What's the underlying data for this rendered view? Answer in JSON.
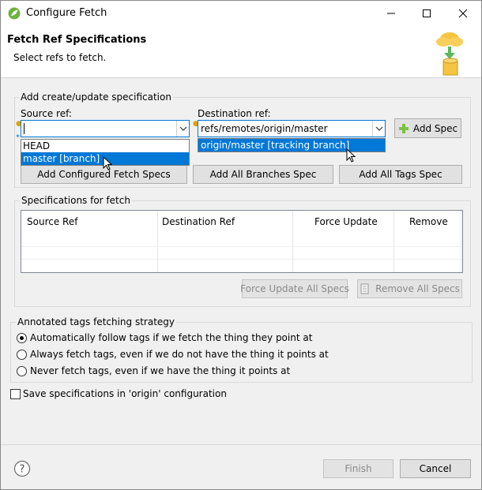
{
  "window": {
    "title": "Configure Fetch",
    "minimize_icon": "minimize-icon",
    "maximize_icon": "maximize-icon",
    "close_icon": "close-icon"
  },
  "header": {
    "title": "Fetch Ref Specifications",
    "description": "Select refs to fetch.",
    "image_icon": "cloud-download-database-icon"
  },
  "create_group": {
    "label": "Add create/update specification",
    "source_label": "Source ref:",
    "source_value": "",
    "destination_label": "Destination ref:",
    "destination_value": "refs/remotes/origin/master",
    "add_spec_label": "Add Spec",
    "source_dropdown": [
      {
        "label": "HEAD",
        "selected": false
      },
      {
        "label": "master [branch]",
        "selected": true
      }
    ],
    "destination_dropdown": [
      {
        "label": "origin/master [tracking branch]",
        "selected": true
      }
    ],
    "add_configured_label": "Add Configured Fetch Specs",
    "add_all_branches_label": "Add All Branches Spec",
    "add_all_tags_label": "Add All Tags Spec"
  },
  "specs_group": {
    "label": "Specifications for fetch",
    "columns": [
      "Source Ref",
      "Destination Ref",
      "Force Update",
      "Remove"
    ],
    "rows": [],
    "force_update_all_label": "Force Update All Specs",
    "remove_all_label": "Remove All Specs"
  },
  "tags_group": {
    "label": "Annotated tags fetching strategy",
    "options": [
      {
        "label": "Automatically follow tags if we fetch the thing they point at",
        "checked": true
      },
      {
        "label": "Always fetch tags, even if we do not have the thing it points at",
        "checked": false
      },
      {
        "label": "Never fetch tags, even if we have the thing it points at",
        "checked": false
      }
    ]
  },
  "save_checkbox": {
    "label": "Save specifications in 'origin' configuration",
    "checked": false
  },
  "footer": {
    "help_icon": "help-icon",
    "finish_label": "Finish",
    "cancel_label": "Cancel"
  },
  "colors": {
    "accent": "#0078d7",
    "background": "#f0f0f0"
  }
}
